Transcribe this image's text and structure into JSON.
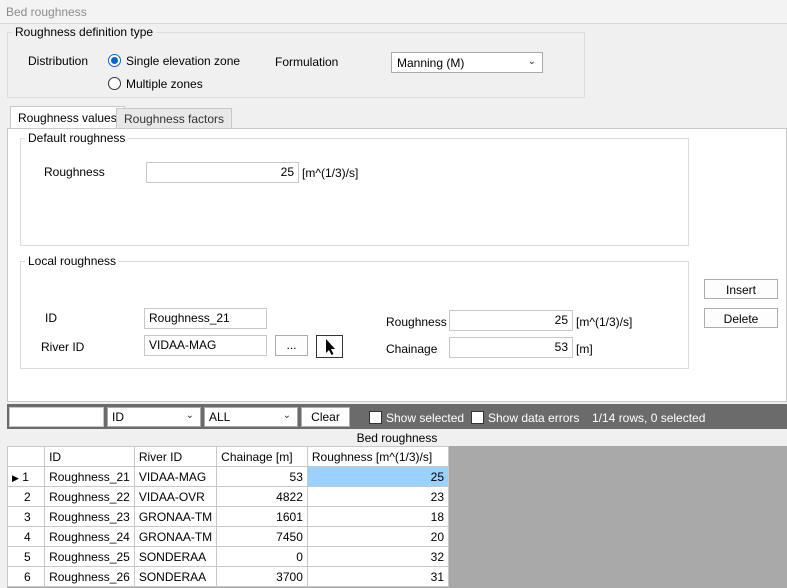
{
  "window": {
    "title": "Bed roughness"
  },
  "definition": {
    "group_title": "Roughness definition type",
    "distribution_label": "Distribution",
    "radio_single": "Single elevation zone",
    "radio_multiple": "Multiple zones",
    "formulation_label": "Formulation",
    "formulation_value": "Manning (M)"
  },
  "tabs": [
    {
      "label": "Roughness values",
      "active": true
    },
    {
      "label": "Roughness factors",
      "active": false
    }
  ],
  "default_roughness": {
    "group_title": "Default roughness",
    "roughness_label": "Roughness",
    "roughness_value": "25",
    "unit": "[m^(1/3)/s]"
  },
  "local_roughness": {
    "group_title": "Local roughness",
    "id_label": "ID",
    "id_value": "Roughness_21",
    "river_id_label": "River ID",
    "river_id_value": "VIDAA-MAG",
    "browse_label": "...",
    "roughness_label": "Roughness",
    "roughness_value": "25",
    "roughness_unit": "[m^(1/3)/s]",
    "chainage_label": "Chainage",
    "chainage_value": "53",
    "chainage_unit": "[m]"
  },
  "actions": {
    "insert": "Insert",
    "delete": "Delete"
  },
  "filter_bar": {
    "search_value": "",
    "column_value": "ID",
    "scope_value": "ALL",
    "clear_label": "Clear",
    "show_selected": "Show selected",
    "show_errors": "Show data errors",
    "status": "1/14 rows, 0 selected"
  },
  "table": {
    "caption": "Bed roughness",
    "columns": [
      "",
      "ID",
      "River ID",
      "Chainage [m]",
      "Roughness [m^(1/3)/s]"
    ],
    "rows": [
      {
        "n": "1",
        "id": "Roughness_21",
        "river": "VIDAA-MAG",
        "chainage": "53",
        "roughness": "25",
        "current": true
      },
      {
        "n": "2",
        "id": "Roughness_22",
        "river": "VIDAA-OVR",
        "chainage": "4822",
        "roughness": "23"
      },
      {
        "n": "3",
        "id": "Roughness_23",
        "river": "GRONAA-TM",
        "chainage": "1601",
        "roughness": "18"
      },
      {
        "n": "4",
        "id": "Roughness_24",
        "river": "GRONAA-TM",
        "chainage": "7450",
        "roughness": "20"
      },
      {
        "n": "5",
        "id": "Roughness_25",
        "river": "SONDERAA",
        "chainage": "0",
        "roughness": "32"
      },
      {
        "n": "6",
        "id": "Roughness_26",
        "river": "SONDERAA",
        "chainage": "3700",
        "roughness": "31"
      }
    ]
  },
  "colors": {
    "accent": "#0a64c8",
    "selected_cell": "#99d1ff",
    "grid_background": "#a9a9a9",
    "toolbar": "#6b6b6b"
  }
}
